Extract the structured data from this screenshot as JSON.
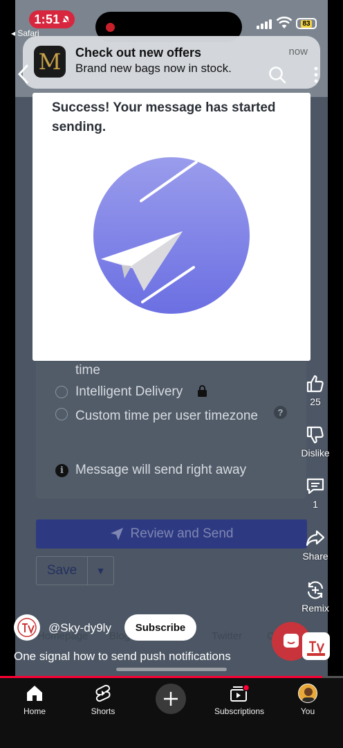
{
  "status_bar": {
    "time": "1:51",
    "back_app": "Safari",
    "battery": "83"
  },
  "notification": {
    "app_initial": "M",
    "title": "Check out new offers",
    "body": "Brand new bags now in stock.",
    "time": "now"
  },
  "modal": {
    "message": "Success! Your message has started sending."
  },
  "form": {
    "option_partial": "time",
    "option_intelligent": "Intelligent Delivery",
    "option_custom": "Custom time per user timezone",
    "info_text": "Message will send right away",
    "review_button": "Review and Send",
    "save_button": "Save",
    "bg_links": [
      "Homepage",
      "Blog",
      "Twitter",
      "C"
    ]
  },
  "rail": {
    "like_count": "25",
    "dislike_label": "Dislike",
    "comment_count": "1",
    "share_label": "Share",
    "remix_label": "Remix"
  },
  "channel": {
    "handle": "@Sky-dy9ly",
    "subscribe_label": "Subscribe",
    "caption": "One signal how to send push notifications"
  },
  "playback_progress": 0.94,
  "bottom_nav": {
    "items": [
      "Home",
      "Shorts",
      "Subscriptions",
      "You"
    ]
  },
  "colors": {
    "modal_illustration": "#7b7fe8",
    "review_button": "#2d3a82",
    "progress": "#ff0033"
  }
}
